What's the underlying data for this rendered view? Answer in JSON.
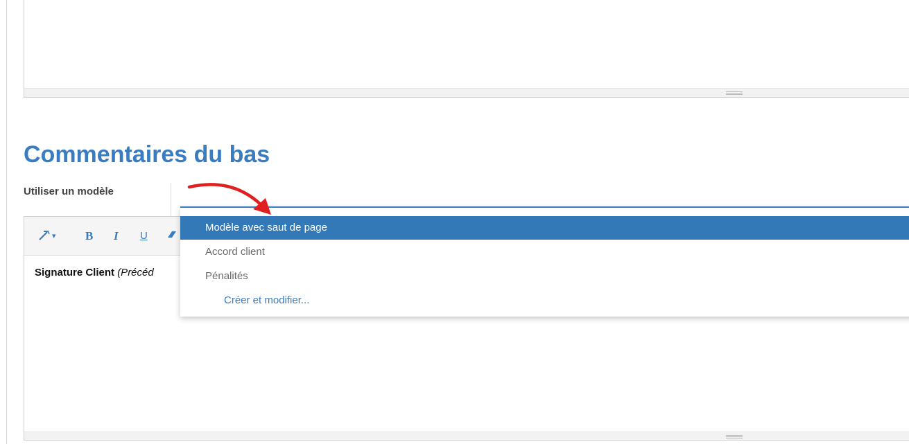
{
  "section": {
    "title": "Commentaires du bas",
    "template_label": "Utiliser un modèle"
  },
  "toolbar": {
    "style_icon": "magic-wand-icon",
    "style_caret": "▾",
    "bold": "B",
    "italic": "I",
    "underline": "U",
    "eraser_icon": "eraser-icon"
  },
  "editor": {
    "content_bold": "Signature Client",
    "content_italic": "(Précéd"
  },
  "dropdown": {
    "items": [
      {
        "label": "Modèle avec saut de page",
        "selected": true
      },
      {
        "label": "Accord client",
        "selected": false
      },
      {
        "label": "Pénalités",
        "selected": false
      }
    ],
    "create_link": "Créer et modifier..."
  },
  "colors": {
    "accent": "#3a7cc0",
    "selected_bg": "#3379b8",
    "annotation_arrow": "#e02020"
  }
}
